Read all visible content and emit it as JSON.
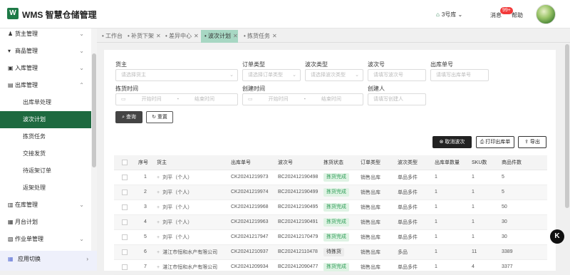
{
  "header": {
    "logo_letter": "W",
    "app_title": "WMS 智慧仓储管理",
    "warehouse": "3号库",
    "messages": "消息",
    "badge": "99+",
    "help": "帮助"
  },
  "sidebar": {
    "items": [
      {
        "label": "货主管理",
        "icon": "user-icon",
        "chevron": "⌄"
      },
      {
        "label": "商品管理",
        "icon": "cart-icon",
        "chevron": "⌄"
      },
      {
        "label": "入库管理",
        "icon": "inbox-icon",
        "chevron": "⌄"
      },
      {
        "label": "出库管理",
        "icon": "outbox-icon",
        "chevron": "⌃"
      },
      {
        "label": "出库单处理"
      },
      {
        "label": "波次计划"
      },
      {
        "label": "拣货任务"
      },
      {
        "label": "交接发货"
      },
      {
        "label": "待返架订单"
      },
      {
        "label": "返架处理"
      },
      {
        "label": "在库管理",
        "icon": "inventory-icon",
        "chevron": "⌄"
      },
      {
        "label": "月台计划",
        "icon": "dock-icon",
        "chevron": ""
      },
      {
        "label": "作业单管理",
        "icon": "workorder-icon",
        "chevron": "⌄"
      }
    ],
    "footer": "应用切换"
  },
  "tabs": [
    {
      "label": "工作台"
    },
    {
      "label": "补货下架"
    },
    {
      "label": "差异中心"
    },
    {
      "label": "波次计划"
    },
    {
      "label": "拣货任务"
    }
  ],
  "filters": {
    "owner": {
      "label": "货主",
      "placeholder": "请选择货主"
    },
    "order_type": {
      "label": "订单类型",
      "placeholder": "请选择订单类型"
    },
    "wave_type": {
      "label": "波次类型",
      "placeholder": "请选择波次类型"
    },
    "wave_no": {
      "label": "波次号",
      "placeholder": "请填写波次号"
    },
    "outbound_no": {
      "label": "出库单号",
      "placeholder": "请填写出库单号"
    },
    "pick_time": {
      "label": "拣货时间",
      "start": "开始时间",
      "sep": "-",
      "end": "结束时间"
    },
    "create_time": {
      "label": "创建时间",
      "start": "开始时间",
      "sep": "-",
      "end": "结束时间"
    },
    "creator": {
      "label": "创建人",
      "placeholder": "请填写创建人"
    }
  },
  "buttons": {
    "query": "查询",
    "reset": "重置",
    "cancel_wave": "取消波次",
    "print_outbound": "打印出库单",
    "export": "导出"
  },
  "table": {
    "headers": [
      "",
      "序号",
      "货主",
      "出库单号",
      "波次号",
      "拣货状态",
      "订单类型",
      "波次类型",
      "出库单数量",
      "SKU数",
      "商品件数"
    ],
    "rows": [
      {
        "no": "1",
        "owner": "刘平（个人）",
        "outbound": "CK20241219973",
        "wave": "BC202412190498",
        "status": "拣货完成",
        "order_type": "销售出库",
        "wave_type": "单品多件",
        "qty": "1",
        "sku": "1",
        "items": "5"
      },
      {
        "no": "2",
        "owner": "刘平（个人）",
        "outbound": "CK20241219974",
        "wave": "BC202412190499",
        "status": "拣货完成",
        "order_type": "销售出库",
        "wave_type": "单品多件",
        "qty": "1",
        "sku": "1",
        "items": "5"
      },
      {
        "no": "3",
        "owner": "刘平（个人）",
        "outbound": "CK20241219968",
        "wave": "BC202412190495",
        "status": "拣货完成",
        "order_type": "销售出库",
        "wave_type": "单品多件",
        "qty": "1",
        "sku": "1",
        "items": "50"
      },
      {
        "no": "4",
        "owner": "刘平（个人）",
        "outbound": "CK20241219963",
        "wave": "BC202412190491",
        "status": "拣货完成",
        "order_type": "销售出库",
        "wave_type": "单品多件",
        "qty": "1",
        "sku": "1",
        "items": "30"
      },
      {
        "no": "5",
        "owner": "刘平（个人）",
        "outbound": "CK20241217947",
        "wave": "BC202412170479",
        "status": "拣货完成",
        "order_type": "销售出库",
        "wave_type": "单品多件",
        "qty": "1",
        "sku": "1",
        "items": "30"
      },
      {
        "no": "6",
        "owner": "湛江市恒和水产有限公司",
        "outbound": "CK20241210937",
        "wave": "BC202412110478",
        "status": "待拣货",
        "order_type": "销售出库",
        "wave_type": "多品",
        "qty": "1",
        "sku": "11",
        "items": "3389"
      },
      {
        "no": "7",
        "owner": "湛江市恒和水产有限公司",
        "outbound": "CK20241209934",
        "wave": "BC202412090477",
        "status": "拣货完成",
        "order_type": "销售出库",
        "wave_type": "单品多件",
        "qty": "1",
        "sku": "4",
        "items": "3377"
      }
    ]
  },
  "colors": {
    "brand": "#1e6a40",
    "active_tab": "#a7d7c3",
    "status_done_bg": "#dff3e4",
    "status_done_fg": "#2f9e58"
  }
}
